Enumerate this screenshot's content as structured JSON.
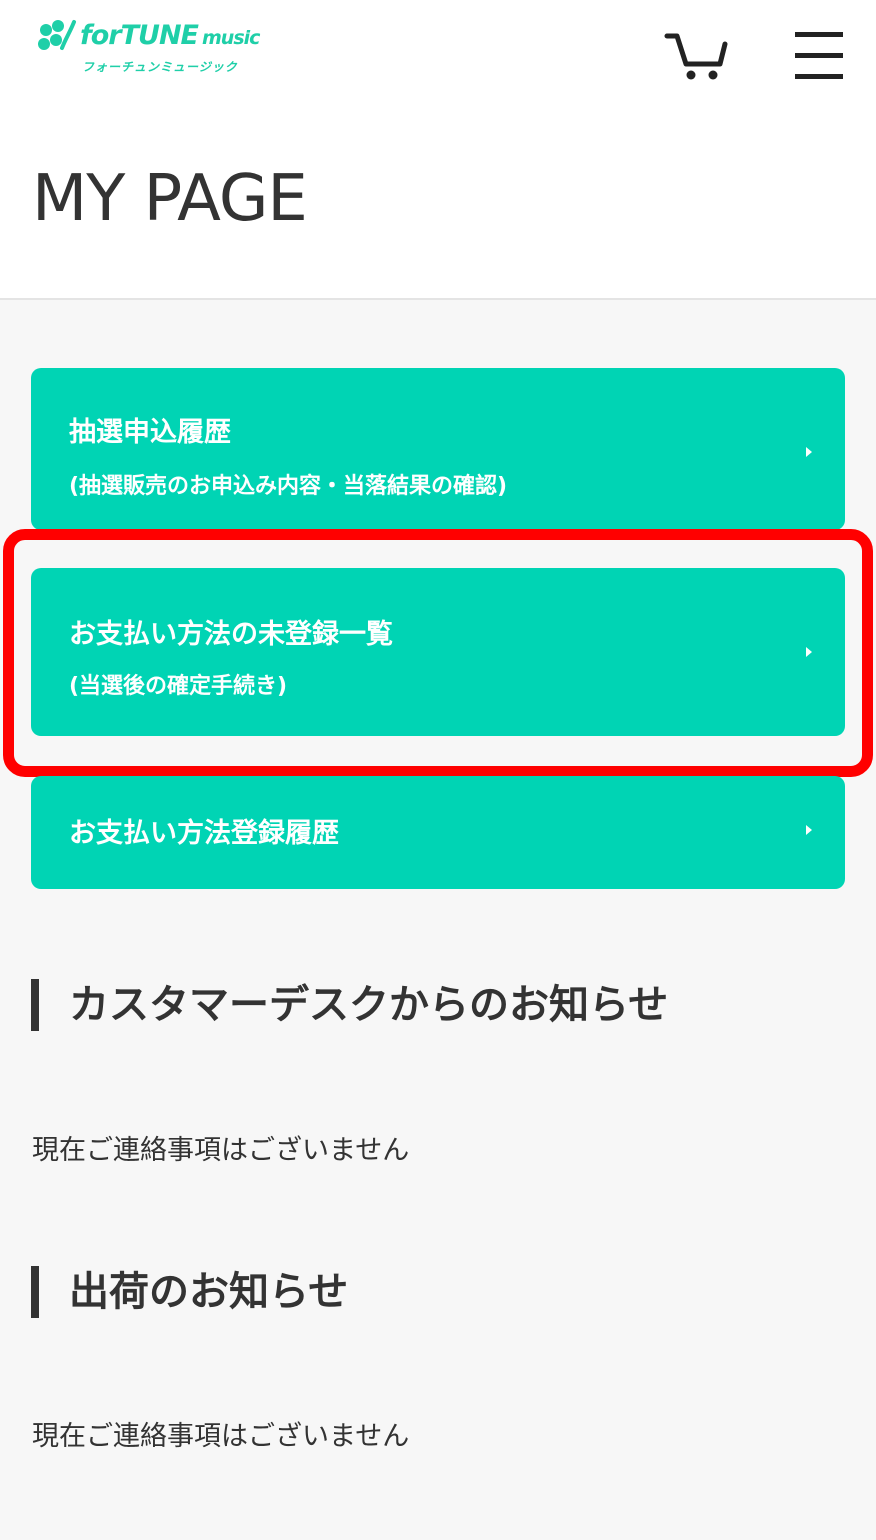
{
  "header": {
    "logo": {
      "brand_text": "forTUNE",
      "brand_suffix": "music",
      "kana_text": "フォーチュンミュージック"
    },
    "icons": {
      "cart": "cart-icon",
      "menu": "hamburger-menu-icon"
    },
    "page_title": "MY PAGE"
  },
  "colors": {
    "accent": "#00d4b4",
    "highlight": "#ff0000",
    "text": "#333333",
    "background": "#f7f7f7"
  },
  "menu": {
    "items": [
      {
        "label": "抽選申込履歴",
        "sub": "(抽選販売のお申込み内容・当落結果の確認)"
      },
      {
        "label": "お支払い方法の未登録一覧",
        "sub": "(当選後の確定手続き)"
      },
      {
        "label": "お支払い方法登録履歴"
      }
    ]
  },
  "sections": [
    {
      "heading": "カスタマーデスクからのお知らせ",
      "message": "現在ご連絡事項はございません"
    },
    {
      "heading": "出荷のお知らせ",
      "message": "現在ご連絡事項はございません"
    }
  ]
}
